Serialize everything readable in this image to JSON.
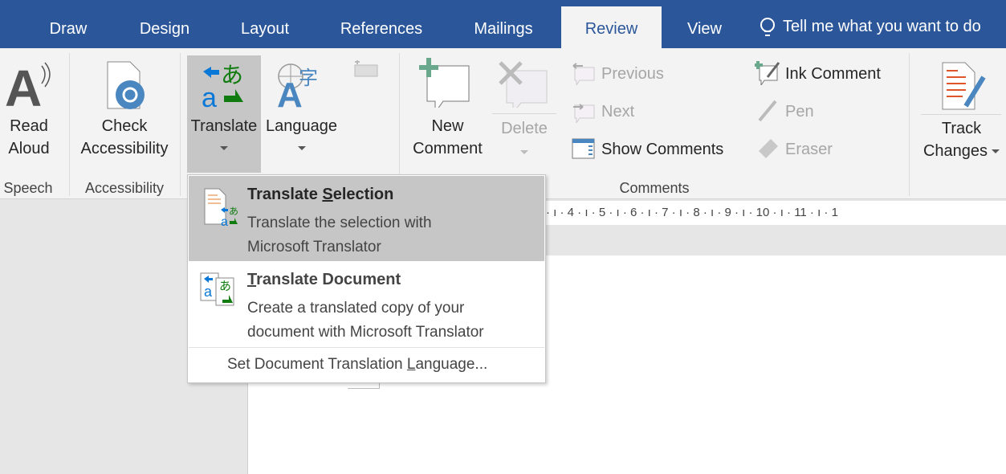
{
  "tabs": [
    {
      "label": "Draw"
    },
    {
      "label": "Design"
    },
    {
      "label": "Layout"
    },
    {
      "label": "References"
    },
    {
      "label": "Mailings"
    },
    {
      "label": "Review",
      "active": true
    },
    {
      "label": "View"
    }
  ],
  "tell_me": {
    "placeholder": "Tell me what you want to do",
    "icon": "lightbulb-icon"
  },
  "ribbon": {
    "read_aloud": [
      "Read",
      "Aloud"
    ],
    "check_accessibility": [
      "Check",
      "Accessibility"
    ],
    "translate": "Translate",
    "language": "Language",
    "new_comment": [
      "New",
      "Comment"
    ],
    "delete": "Delete",
    "previous": "Previous",
    "next": "Next",
    "show_comments": "Show Comments",
    "ink_comment": "Ink Comment",
    "pen": "Pen",
    "eraser": "Eraser",
    "track_changes": [
      "Track",
      "Changes"
    ],
    "groups": {
      "speech": "Speech",
      "accessibility": "Accessibility",
      "comments": "Comments"
    }
  },
  "ruler": "· ı · 4 · ı · 5 · ı · 6 · ı · 7 · ı · 8 · ı · 9 · ı · 10 · ı · 11 · ı · 1",
  "menu": {
    "translate_selection": {
      "title_pre": "Translate ",
      "title_u": "S",
      "title_post": "election",
      "desc": [
        "Translate the selection with",
        "Microsoft Translator"
      ]
    },
    "translate_document": {
      "title_u": "T",
      "title_post": "ranslate Document",
      "desc": [
        "Create a translated copy of your",
        "document with Microsoft Translator"
      ]
    },
    "set_language": {
      "pre": "Set Document Translation ",
      "u": "L",
      "post": "anguage..."
    }
  },
  "colors": {
    "accent": "#2b579a",
    "hover": "#c6c6c6",
    "translate_blue": "#0a78d7",
    "translate_green": "#107c10"
  }
}
